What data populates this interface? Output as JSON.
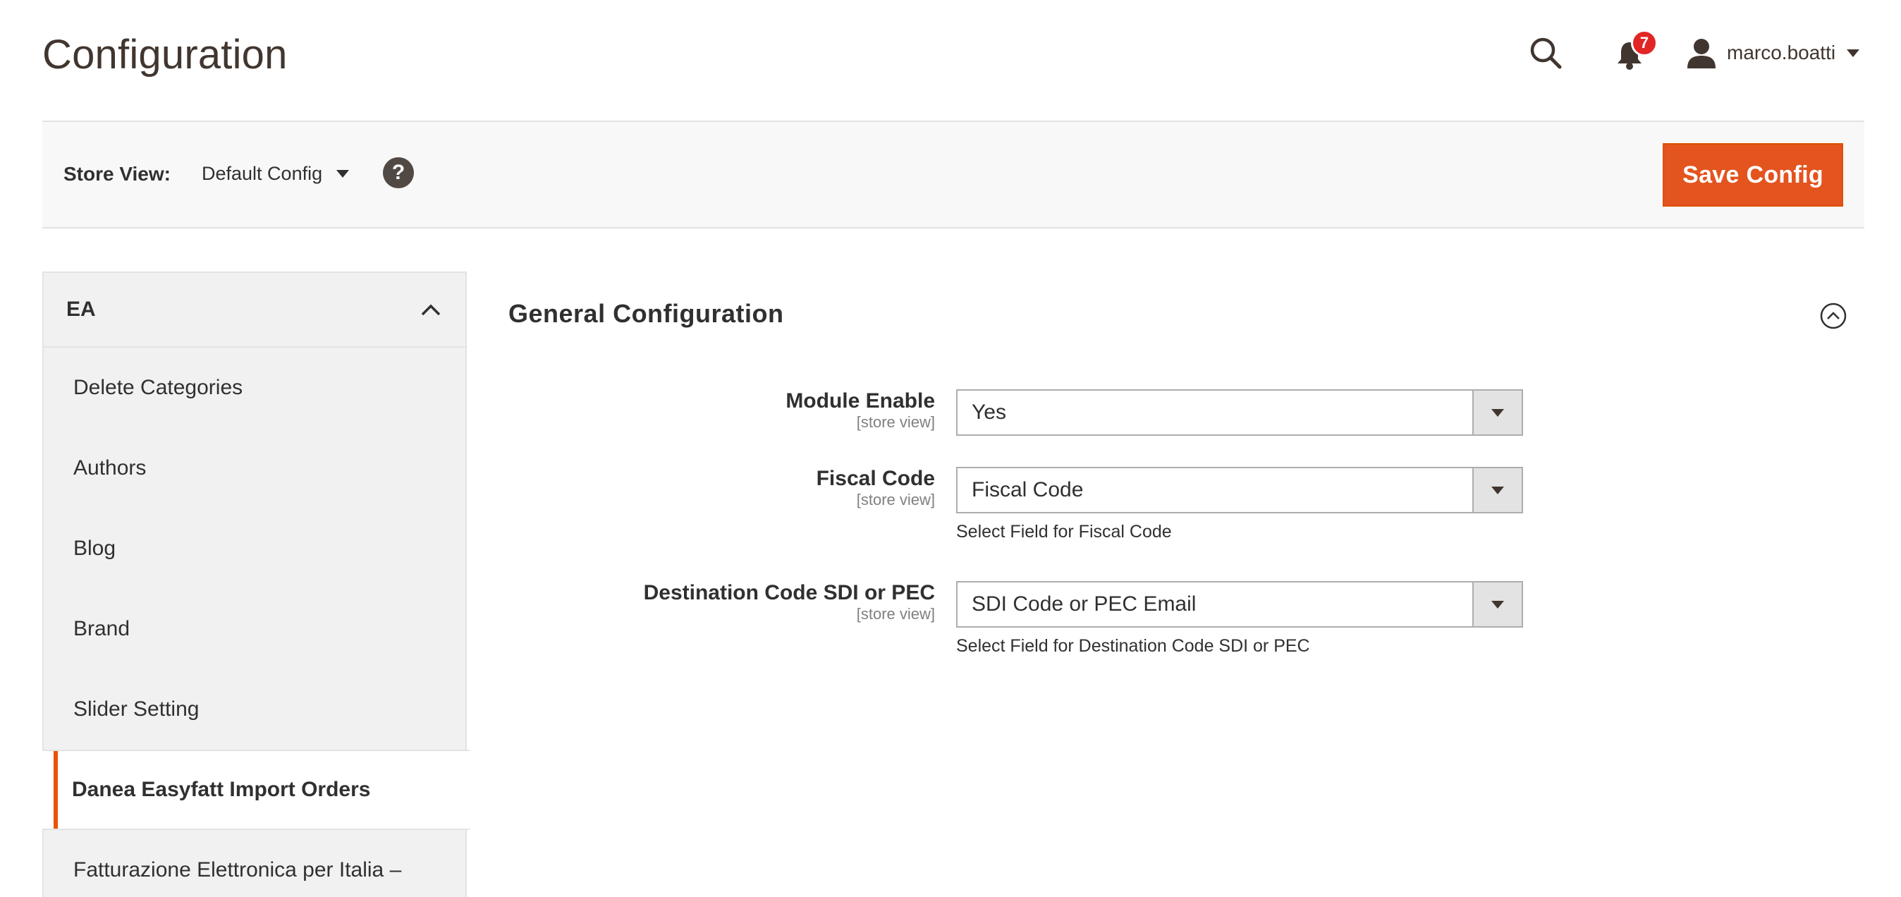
{
  "header": {
    "title": "Configuration",
    "notifications_count": "7",
    "user_name": "marco.boatti"
  },
  "store_bar": {
    "label": "Store View:",
    "value": "Default Config",
    "help": "?",
    "save_label": "Save Config"
  },
  "sidebar": {
    "section_title": "EA",
    "items": [
      {
        "label": "Delete Categories",
        "active": false
      },
      {
        "label": "Authors",
        "active": false
      },
      {
        "label": "Blog",
        "active": false
      },
      {
        "label": "Brand",
        "active": false
      },
      {
        "label": "Slider Setting",
        "active": false
      },
      {
        "label": "Danea Easyfatt Import Orders",
        "active": true
      },
      {
        "label": "Fatturazione Elettronica per Italia –",
        "active": false
      }
    ]
  },
  "main": {
    "section_title": "General Configuration",
    "fields": [
      {
        "label": "Module Enable",
        "scope": "[store view]",
        "value": "Yes",
        "note": ""
      },
      {
        "label": "Fiscal Code",
        "scope": "[store view]",
        "value": "Fiscal Code",
        "note": "Select Field for Fiscal Code"
      },
      {
        "label": "Destination Code SDI or PEC",
        "scope": "[store view]",
        "value": "SDI Code or PEC Email",
        "note": "Select Field for Destination Code SDI or PEC"
      }
    ]
  },
  "colors": {
    "accent": "#eb5202",
    "badge": "#e22626",
    "text": "#303030"
  },
  "icons": [
    "search-icon",
    "bell-icon",
    "user-icon",
    "help-icon",
    "chevron-up-icon",
    "collapse-circle-icon"
  ]
}
